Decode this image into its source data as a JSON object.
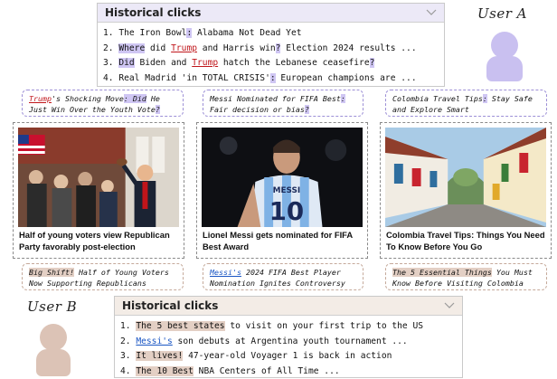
{
  "user_a": {
    "label": "User A",
    "panel_title": "Historical clicks",
    "clicks": [
      {
        "num": "1.",
        "pre": "The Iron Bowl",
        "hl": ":",
        "post": " Alabama Not Dead Yet"
      },
      {
        "num": "2.",
        "hl1": "Where",
        "mid1": " did ",
        "link": "Trump",
        "mid2": " and Harris win",
        "hl2": "?",
        "post": " Election 2024 results ..."
      },
      {
        "num": "3.",
        "hl1": "Did",
        "mid1": " Biden and ",
        "link": "Trump",
        "mid2": " hatch the Lebanese ceasefire",
        "hl2": "?"
      },
      {
        "num": "4.",
        "pre": "Real Madrid 'in TOTAL CRISIS'",
        "hl": ":",
        "post": " European champions are ..."
      }
    ]
  },
  "user_b": {
    "label": "User B",
    "panel_title": "Historical clicks",
    "clicks": [
      {
        "num": "1.",
        "hl": "The 5 best states",
        "post": " to visit on your first trip to the US"
      },
      {
        "num": "2.",
        "link": "Messi's",
        "post": " son debuts at Argentina youth tournament ..."
      },
      {
        "num": "3.",
        "hl": "It lives!",
        "post": " 47-year-old Voyager 1 is back in action"
      },
      {
        "num": "4.",
        "hl": "The 10 Best",
        "post": " NBA Centers of All Time ..."
      }
    ]
  },
  "rewrites_a": [
    {
      "link": "Trump",
      "t1": "'s Shocking Move",
      "hl1": ": Did",
      "t2": " He Just Win Over the Youth Vote",
      "hl2": "?"
    },
    {
      "t1": "Messi Nominated for FIFA Best",
      "hl1": ":",
      "t2": " Fair decision or bias",
      "hl2": "?"
    },
    {
      "t1": "Colombia  Travel  Tips",
      "hl1": ":",
      "t2": "  Stay Safe and Explore Smart"
    }
  ],
  "news": [
    {
      "title": "Half of young voters view Republican Party favorably post-election"
    },
    {
      "title": "Lionel Messi gets nominated for FIFA Best Award"
    },
    {
      "title": "Colombia Travel Tips: Things You Need To Know Before You Go"
    }
  ],
  "rewrites_b": [
    {
      "hl": "Big Shift!",
      "t": " Half of Young Voters Now Supporting Republicans"
    },
    {
      "link": "Messi's",
      "t": " 2024 FIFA Best Player Nomination Ignites Controversy"
    },
    {
      "hl": "The 5 Essential Things",
      "t": " You Must Know Before Visiting Colombia"
    }
  ],
  "jersey": {
    "name": "MESSI",
    "number": "10"
  },
  "colors": {
    "user_a_accent": "#cfc6f3",
    "user_b_accent": "#e3cfc4",
    "trump_link": "#c0151a",
    "messi_link": "#1a56c4"
  },
  "icons": [
    "chevron-down-icon",
    "user-a-avatar",
    "user-b-avatar"
  ]
}
